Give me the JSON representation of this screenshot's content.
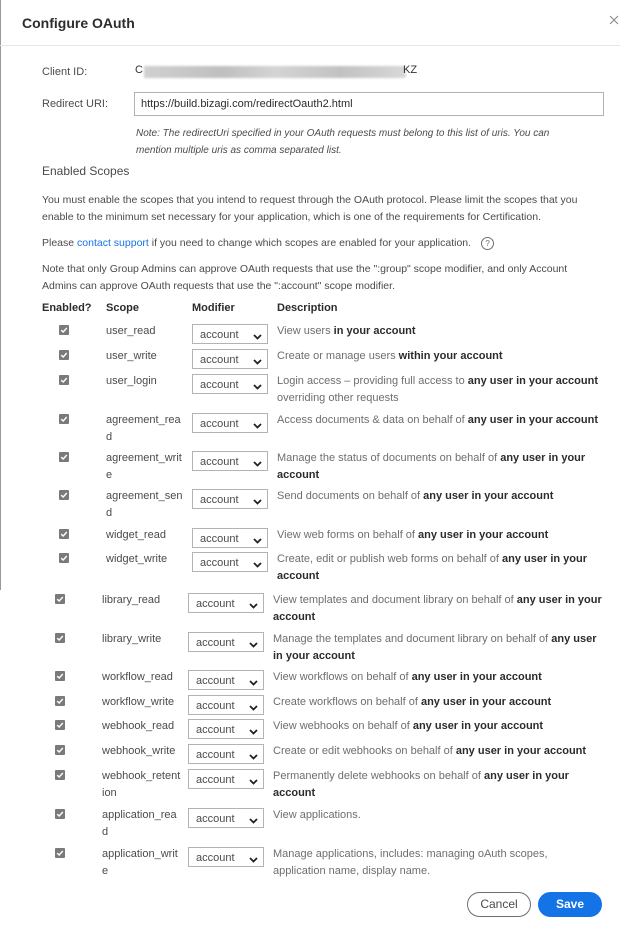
{
  "dialog": {
    "title": "Configure OAuth",
    "close_icon": "close-icon"
  },
  "form": {
    "client_id_label": "Client ID:",
    "client_id_prefix": "C",
    "client_id_suffix": "KZ",
    "client_id_redacted": true,
    "redirect_uri_label": "Redirect URI:",
    "redirect_uri_value": "https://build.bizagi.com/redirectOauth2.html",
    "redirect_note": "Note: The redirectUri specified in your OAuth requests must belong to this list of uris. You can mention multiple uris as comma separated list."
  },
  "scopes_section": {
    "title": "Enabled Scopes",
    "intro": "You must enable the scopes that you intend to request through the OAuth protocol. Please limit the scopes that you enable to the minimum set necessary for your application, which is one of the requirements for Certification.",
    "support_prefix": "Please ",
    "support_link": "contact support",
    "support_suffix": " if you need to change which scopes are enabled for your application.",
    "help_icon": "help-circle-icon",
    "admin_note": "Note that only Group Admins can approve OAuth requests that use the \":group\" scope modifier, and only Account Admins can approve OAuth requests that use the \":account\" scope modifier.",
    "columns": [
      "Enabled?",
      "Scope",
      "Modifier",
      "Description"
    ]
  },
  "scopes": [
    {
      "enabled": true,
      "scope": "user_read",
      "modifier": "account",
      "desc_plain": "View users ",
      "desc_bold": "in your account"
    },
    {
      "enabled": true,
      "scope": "user_write",
      "modifier": "account",
      "desc_plain": "Create or manage users ",
      "desc_bold": "within your account"
    },
    {
      "enabled": true,
      "scope": "user_login",
      "modifier": "account",
      "desc_plain": "Login access – providing full access to ",
      "desc_bold": "any user in your account",
      "desc_after": " overriding other requests"
    },
    {
      "enabled": true,
      "scope": "agreement_read",
      "modifier": "account",
      "desc_plain": "Access documents & data on behalf of ",
      "desc_bold": "any user in your account"
    },
    {
      "enabled": true,
      "scope": "agreement_write",
      "modifier": "account",
      "desc_plain": "Manage the status of documents on behalf of ",
      "desc_bold": "any user in your account"
    },
    {
      "enabled": true,
      "scope": "agreement_send",
      "modifier": "account",
      "desc_plain": "Send documents on behalf of ",
      "desc_bold": "any user in your account"
    },
    {
      "enabled": true,
      "scope": "widget_read",
      "modifier": "account",
      "desc_plain": "View web forms on behalf of ",
      "desc_bold": "any user in your account"
    },
    {
      "enabled": true,
      "scope": "widget_write",
      "modifier": "account",
      "desc_plain": "Create, edit or publish web forms on behalf of ",
      "desc_bold": "any user in your account"
    },
    {
      "enabled": true,
      "scope": "library_read",
      "modifier": "account",
      "desc_plain": "View templates and document library on behalf of ",
      "desc_bold": "any user in your account"
    },
    {
      "enabled": true,
      "scope": "library_write",
      "modifier": "account",
      "desc_plain": "Manage the templates and document library on behalf of ",
      "desc_bold": "any user in your account"
    },
    {
      "enabled": true,
      "scope": "workflow_read",
      "modifier": "account",
      "desc_plain": "View workflows on behalf of ",
      "desc_bold": "any user in your account"
    },
    {
      "enabled": true,
      "scope": "workflow_write",
      "modifier": "account",
      "desc_plain": "Create workflows on behalf of ",
      "desc_bold": "any user in your account"
    },
    {
      "enabled": true,
      "scope": "webhook_read",
      "modifier": "account",
      "desc_plain": "View webhooks on behalf of ",
      "desc_bold": "any user in your account"
    },
    {
      "enabled": true,
      "scope": "webhook_write",
      "modifier": "account",
      "desc_plain": "Create or edit webhooks on behalf of ",
      "desc_bold": "any user in your account"
    },
    {
      "enabled": true,
      "scope": "webhook_retention",
      "modifier": "account",
      "desc_plain": "Permanently delete webhooks on behalf of ",
      "desc_bold": "any user in your account"
    },
    {
      "enabled": true,
      "scope": "application_read",
      "modifier": "account",
      "desc_plain": "View applications.",
      "desc_bold": ""
    },
    {
      "enabled": true,
      "scope": "application_write",
      "modifier": "account",
      "desc_plain": "Manage applications, includes: managing oAuth scopes, application name, display name.",
      "desc_bold": ""
    }
  ],
  "footer": {
    "cancel_label": "Cancel",
    "save_label": "Save"
  },
  "colors": {
    "accent": "#1473e6",
    "checkbox": "#7a7a7a"
  }
}
